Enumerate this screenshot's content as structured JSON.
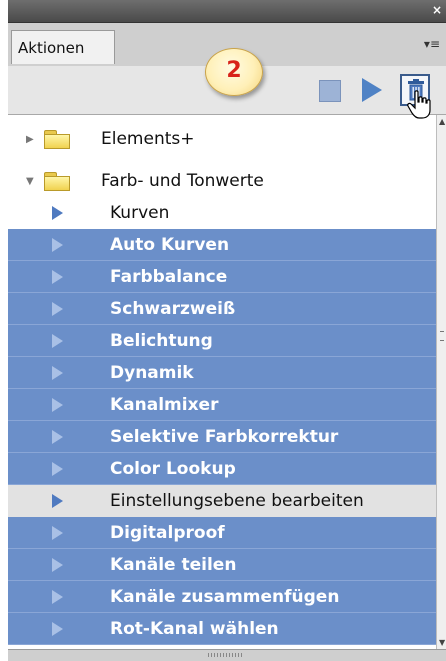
{
  "panel": {
    "close_glyph": "×",
    "tab_label": "Aktionen",
    "panel_menu_glyph": "▾≡"
  },
  "annotation": {
    "badge_number": "2"
  },
  "toolbar": {
    "stop_icon": "stop-icon",
    "play_icon": "play-icon",
    "delete_icon": "trash-icon"
  },
  "list": {
    "folders": [
      {
        "label": "Elements+",
        "expanded": false
      },
      {
        "label": "Farb- und Tonwerte",
        "expanded": true
      }
    ],
    "actions": [
      {
        "label": "Kurven",
        "state": "normal"
      },
      {
        "label": "Auto Kurven",
        "state": "selected"
      },
      {
        "label": "Farbbalance",
        "state": "selected"
      },
      {
        "label": "Schwarzweiß",
        "state": "selected"
      },
      {
        "label": "Belichtung",
        "state": "selected"
      },
      {
        "label": "Dynamik",
        "state": "selected"
      },
      {
        "label": "Kanalmixer",
        "state": "selected"
      },
      {
        "label": "Selektive Farbkorrektur",
        "state": "selected"
      },
      {
        "label": "Color Lookup",
        "state": "selected"
      },
      {
        "label": "Einstellungsebene bearbeiten",
        "state": "highlighted"
      },
      {
        "label": "Digitalproof",
        "state": "selected"
      },
      {
        "label": "Kanäle teilen",
        "state": "selected"
      },
      {
        "label": "Kanäle zusammenfügen",
        "state": "selected"
      },
      {
        "label": "Rot-Kanal wählen",
        "state": "selected"
      }
    ]
  },
  "colors": {
    "selection": "#6b8fc9",
    "highlight": "#e2e2e2",
    "accent_triangle": "#4f7ac0",
    "badge_text": "#d8231a"
  }
}
